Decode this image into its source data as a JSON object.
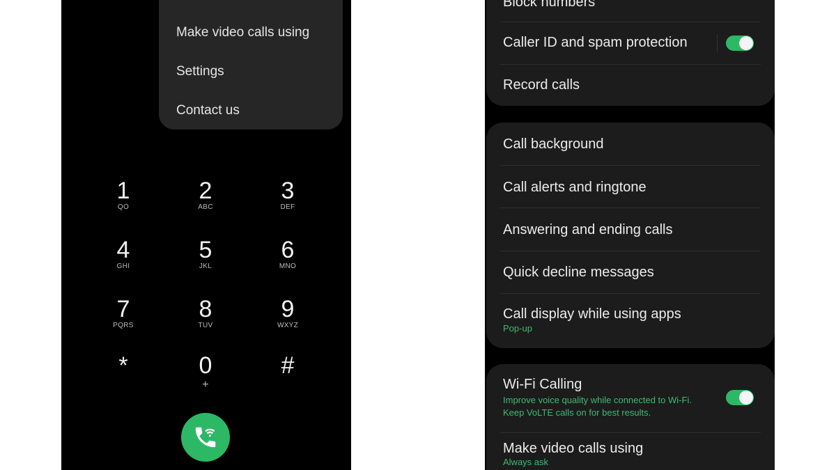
{
  "dialer": {
    "menu_items": [
      "Make video calls using",
      "Settings",
      "Contact us"
    ],
    "keys": [
      {
        "num": "1",
        "letters": "QO"
      },
      {
        "num": "2",
        "letters": "ABC"
      },
      {
        "num": "3",
        "letters": "DEF"
      },
      {
        "num": "4",
        "letters": "GHI"
      },
      {
        "num": "5",
        "letters": "JKL"
      },
      {
        "num": "6",
        "letters": "MNO"
      },
      {
        "num": "7",
        "letters": "PQRS"
      },
      {
        "num": "8",
        "letters": "TUV"
      },
      {
        "num": "9",
        "letters": "WXYZ"
      },
      {
        "num": "*",
        "letters": ""
      },
      {
        "num": "0",
        "letters": "+"
      },
      {
        "num": "#",
        "letters": ""
      }
    ],
    "call_icon": "wifi-call-icon",
    "accent": "#2db865"
  },
  "settings": {
    "group1": [
      {
        "label": "Block numbers"
      },
      {
        "label": "Caller ID and spam protection",
        "toggle": true
      },
      {
        "label": "Record calls"
      }
    ],
    "group2": [
      {
        "label": "Call background"
      },
      {
        "label": "Call alerts and ringtone"
      },
      {
        "label": "Answering and ending calls"
      },
      {
        "label": "Quick decline messages"
      },
      {
        "label": "Call display while using apps",
        "sub": "Pop-up"
      }
    ],
    "group3": [
      {
        "label": "Wi-Fi Calling",
        "sub": "Improve voice quality while connected to Wi-Fi. Keep VoLTE calls on for best results.",
        "toggle": true
      },
      {
        "label": "Make video calls using",
        "sub": "Always ask"
      }
    ]
  }
}
